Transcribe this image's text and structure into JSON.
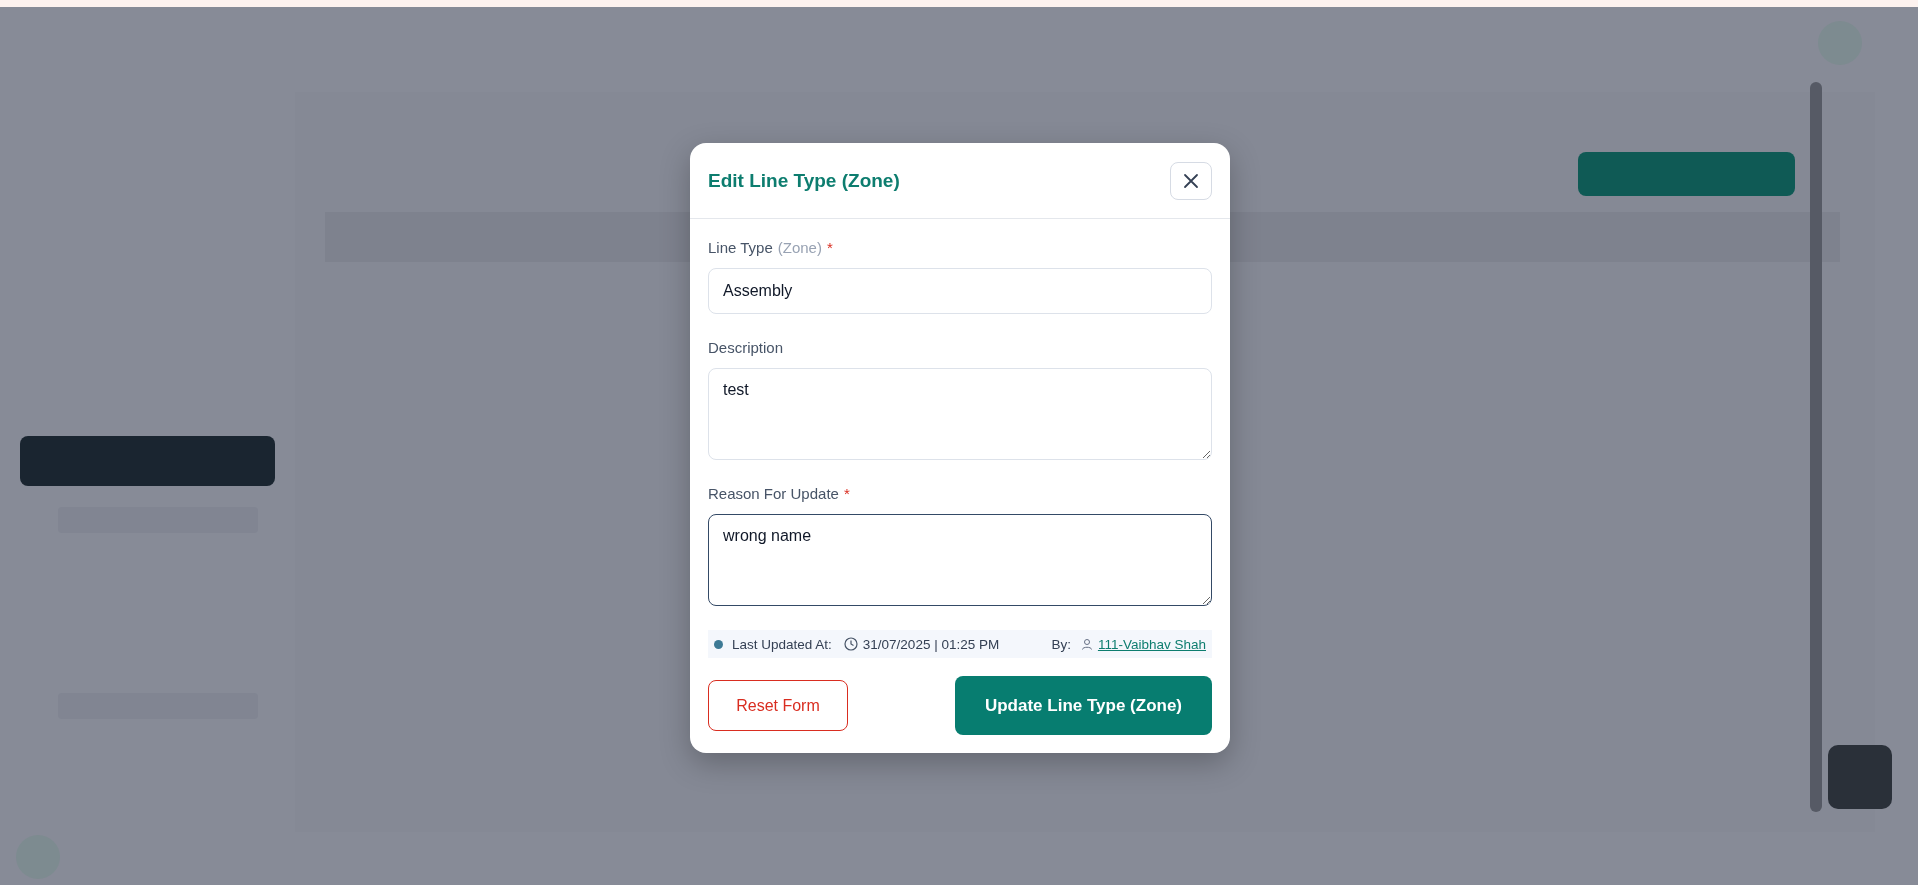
{
  "modal": {
    "title": "Edit Line Type (Zone)",
    "fields": [
      {
        "kind": "input",
        "label": "Line Type",
        "hint": "(Zone)",
        "required_mark": "*",
        "value": "Assembly",
        "focused": false
      },
      {
        "kind": "textarea",
        "label": "Description",
        "value": "test",
        "focused": false
      },
      {
        "kind": "textarea",
        "label": "Reason For Update",
        "required_mark": "*",
        "value": "wrong name",
        "focused": true
      }
    ],
    "meta": {
      "label": "Last Updated At:",
      "datetime": "31/07/2025 | 01:25 PM",
      "by_label": "By:",
      "user": "111-Vaibhav Shah"
    },
    "buttons": [
      {
        "kind": "secondary",
        "label": "Reset Form"
      },
      {
        "kind": "primary",
        "label": "Update Line Type (Zone)"
      }
    ]
  }
}
